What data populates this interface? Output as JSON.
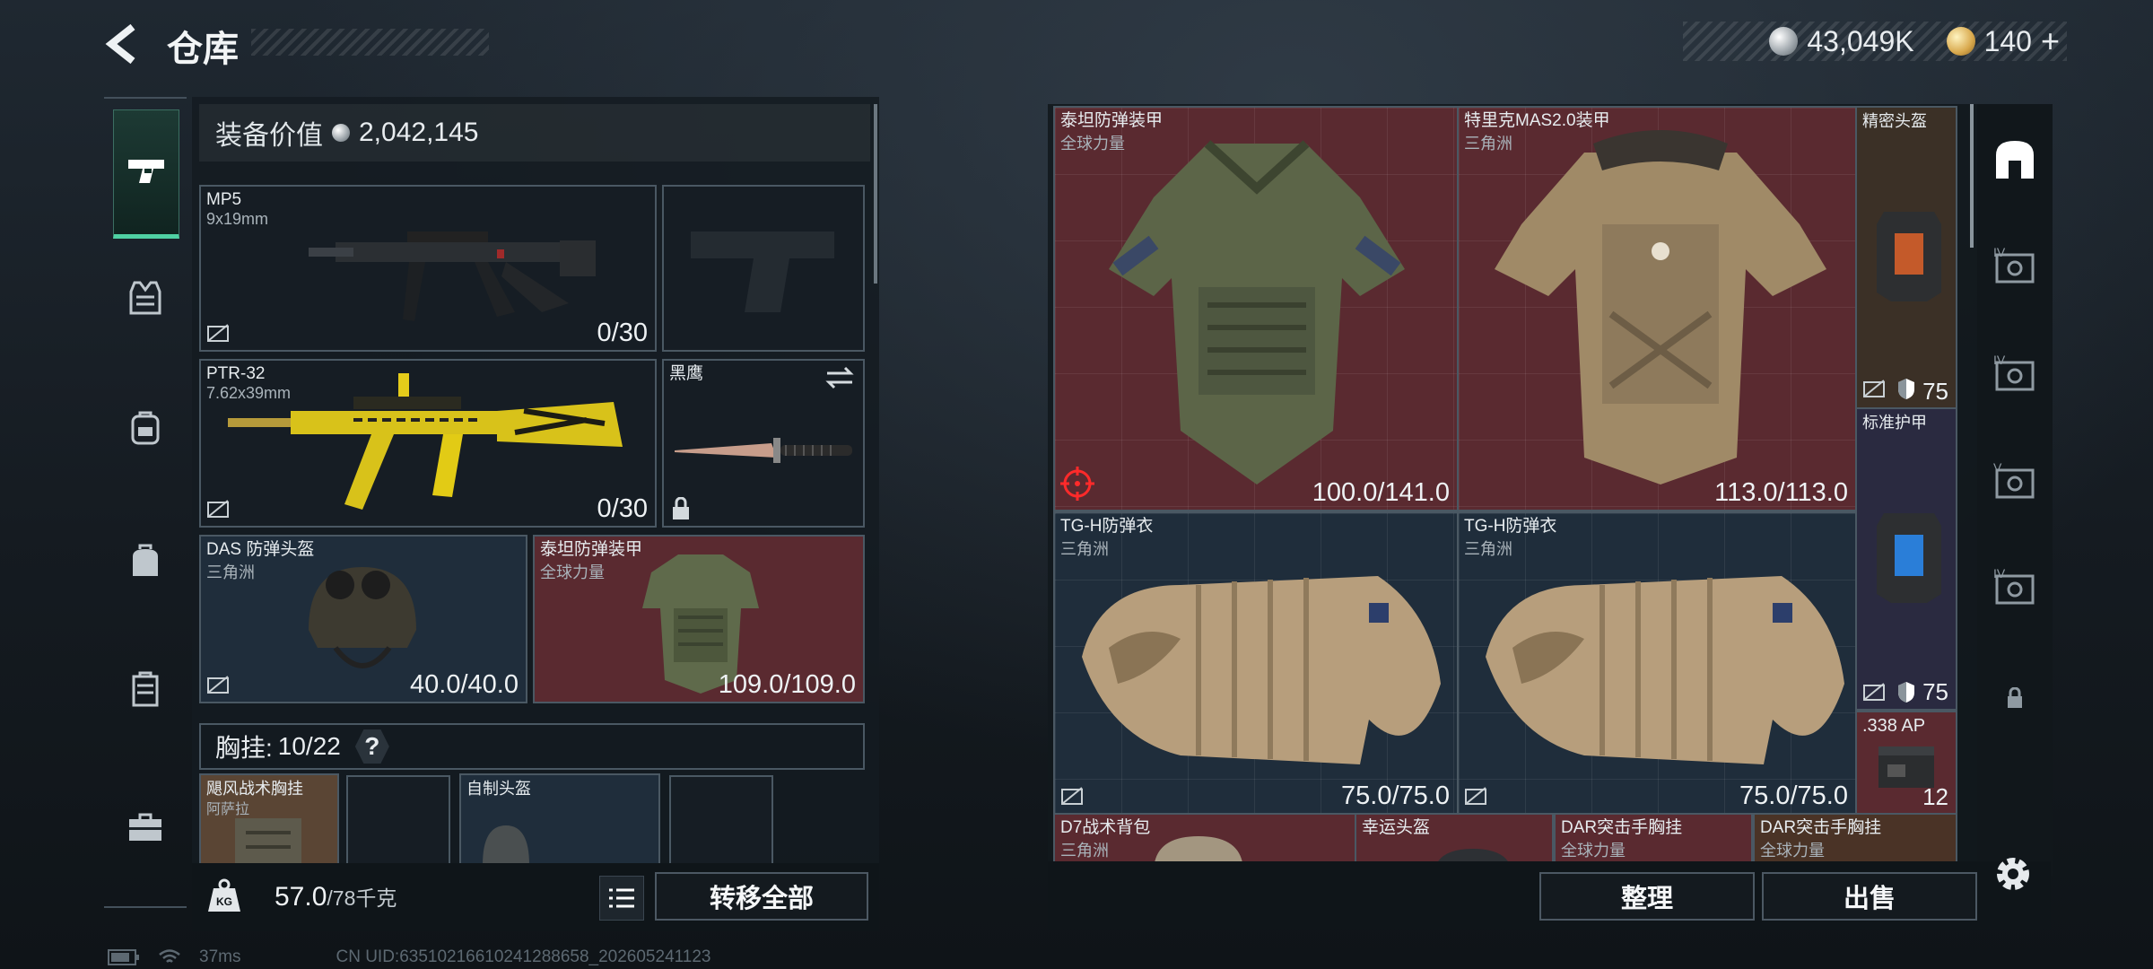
{
  "header": {
    "title": "仓库",
    "currency": [
      {
        "icon": "silver-coin-icon",
        "value": "43,049K"
      },
      {
        "icon": "gold-coin-icon",
        "value": "140"
      }
    ],
    "add_symbol": "+"
  },
  "left_rail": {
    "items": [
      {
        "icon": "pistol-icon",
        "active": true
      },
      {
        "icon": "vest-icon"
      },
      {
        "icon": "backpack-icon"
      },
      {
        "icon": "backpack-alt-icon"
      },
      {
        "icon": "case-icon"
      },
      {
        "icon": "toolbox-icon"
      }
    ]
  },
  "equipment": {
    "value_label": "装备价值",
    "value": "2,042,145",
    "slots": [
      {
        "name": "MP5",
        "sub": "9x19mm",
        "value": "0/30"
      },
      {
        "name": "",
        "sub": "",
        "value": ""
      },
      {
        "name": "PTR-32",
        "sub": "7.62x39mm",
        "value": "0/30"
      },
      {
        "name": "黑鹰",
        "sub": "",
        "value": ""
      },
      {
        "name": "DAS 防弹头盔",
        "sub": "三角洲",
        "value": "40.0/40.0"
      },
      {
        "name": "泰坦防弹装甲",
        "sub": "全球力量",
        "value": "109.0/109.0"
      }
    ],
    "chest_label": "胸挂:",
    "chest_value": "10/22",
    "help": "?",
    "pouch_items": [
      {
        "name": "飓风战术胸挂",
        "sub": "阿萨拉"
      },
      {
        "name": "",
        "sub": ""
      },
      {
        "name": "自制头盔",
        "sub": ""
      },
      {
        "name": "",
        "sub": ""
      }
    ]
  },
  "footer_left": {
    "weight": "57.0",
    "weight_max": "/78千克",
    "transfer_all": "转移全部"
  },
  "stash": {
    "items": [
      {
        "name": "泰坦防弹装甲",
        "sub": "全球力量",
        "value": "100.0/141.0"
      },
      {
        "name": "特里克MAS2.0装甲",
        "sub": "三角洲",
        "value": "113.0/113.0"
      },
      {
        "name": "精密头盔",
        "sub": "",
        "value": "75"
      },
      {
        "name": "标准护甲",
        "sub": "",
        "value": "75"
      },
      {
        "name": "TG-H防弹衣",
        "sub": "三角洲",
        "value": "75.0/75.0"
      },
      {
        "name": "TG-H防弹衣",
        "sub": "三角洲",
        "value": "75.0/75.0"
      },
      {
        "name": ".338 AP",
        "sub": "",
        "value": "12"
      },
      {
        "name": "D7战术背包",
        "sub": "三角洲",
        "value": ""
      },
      {
        "name": "幸运头盔",
        "sub": "",
        "value": ""
      },
      {
        "name": "DAR突击手胸挂",
        "sub": "全球力量",
        "value": ""
      },
      {
        "name": "DAR突击手胸挂",
        "sub": "全球力量",
        "value": ""
      }
    ]
  },
  "stash_rail": {
    "tiers": [
      "IV",
      "IV",
      "V",
      "IV"
    ]
  },
  "footer_right": {
    "sort": "整理",
    "sell": "出售"
  },
  "status": {
    "ping": "37ms",
    "uid": "CN UID:63510216610241288658_202605241123"
  }
}
